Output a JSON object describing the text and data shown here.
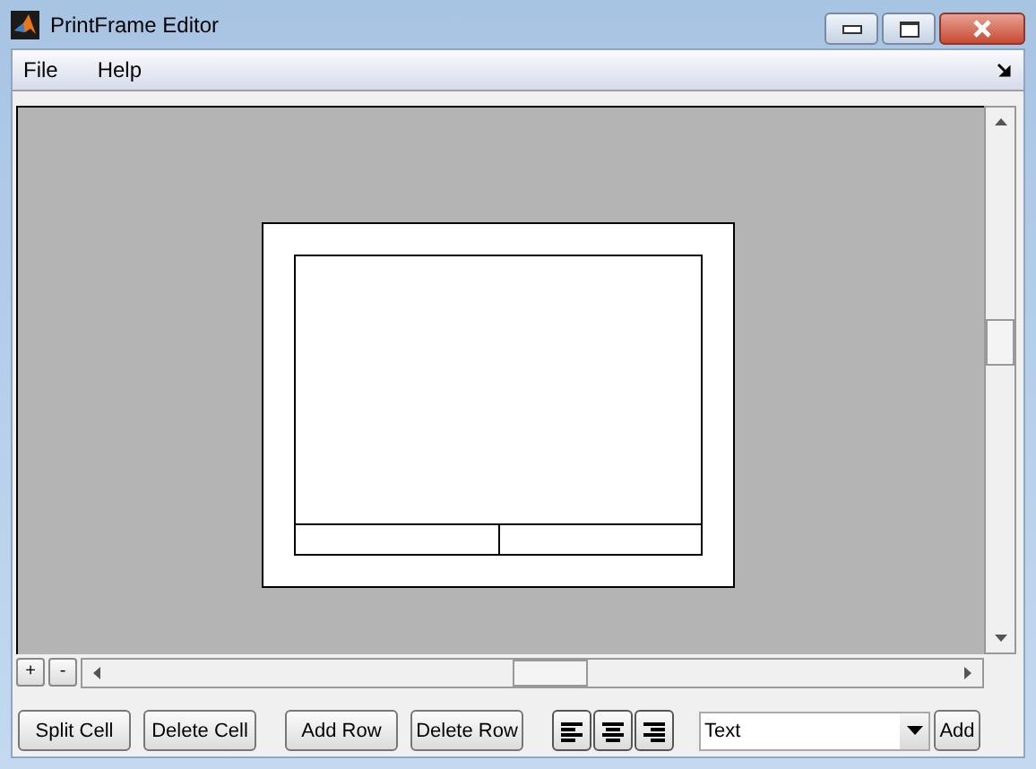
{
  "window": {
    "title": "PrintFrame Editor"
  },
  "menu": [
    {
      "label": "File"
    },
    {
      "label": "Help"
    }
  ],
  "zoom_buttons": [
    {
      "label": "+"
    },
    {
      "label": "-"
    }
  ],
  "buttons": [
    {
      "label": "Split Cell"
    },
    {
      "label": "Delete Cell"
    },
    {
      "label": "Add Row"
    },
    {
      "label": "Delete Row"
    }
  ],
  "align_buttons": [
    {
      "kind": "left"
    },
    {
      "kind": "center"
    },
    {
      "kind": "right"
    }
  ],
  "dropdown": {
    "value": "Text"
  },
  "add_button": {
    "label": "Add"
  }
}
